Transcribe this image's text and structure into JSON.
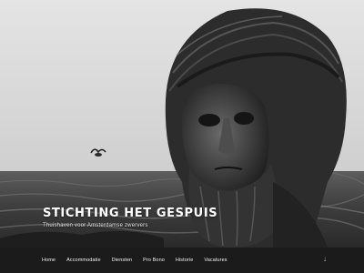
{
  "site": {
    "title": "STICHTING HET GESPUIS",
    "tagline": "Thuishaven voor Amsterdamse zwervers"
  },
  "nav": {
    "items": [
      {
        "label": "Home"
      },
      {
        "label": "Accommodatie"
      },
      {
        "label": "Diensten"
      },
      {
        "label": "Pro Bono"
      },
      {
        "label": "Historie"
      },
      {
        "label": "Vacatures"
      }
    ]
  },
  "icons": {
    "scroll_down": "arrow-down-icon",
    "scroll_down_glyph": "↓"
  },
  "colors": {
    "nav_background": "#1b1b1b",
    "title_text": "#ffffff"
  }
}
